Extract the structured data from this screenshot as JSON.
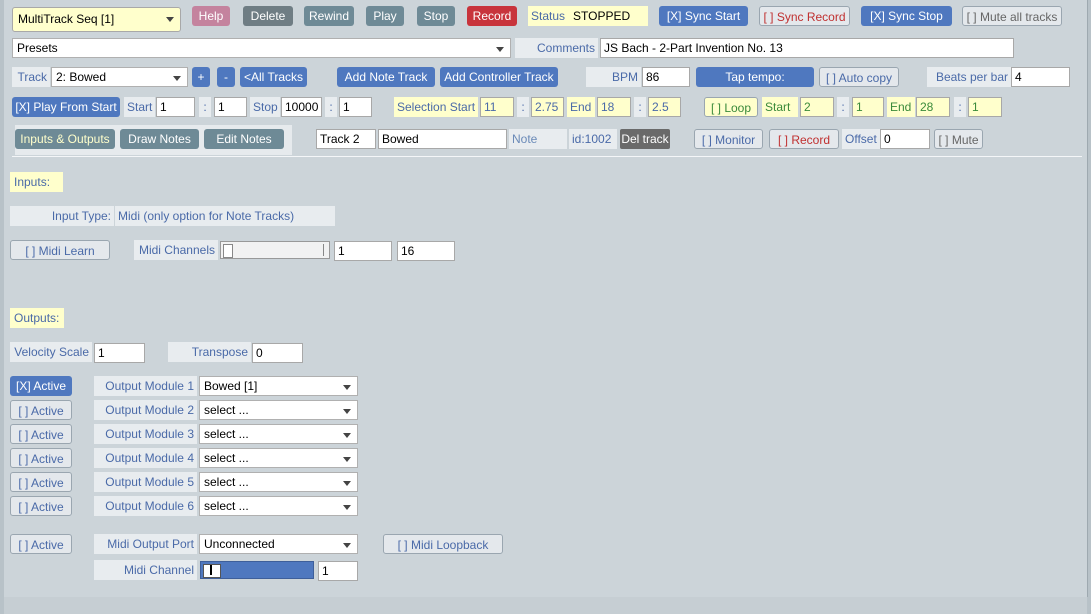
{
  "toolbar": {
    "app_title": "MultiTrack Seq [1]",
    "help": "Help",
    "delete": "Delete",
    "rewind": "Rewind",
    "play": "Play",
    "stop": "Stop",
    "record": "Record",
    "status_label": "Status",
    "status_value": "STOPPED",
    "sync_start": "[X] Sync Start",
    "sync_record": "[ ] Sync Record",
    "sync_stop": "[X] Sync Stop",
    "mute_all": "[ ] Mute all tracks"
  },
  "presets": {
    "value": "Presets",
    "comments_label": "Comments",
    "comments_value": "JS Bach - 2-Part Invention No. 13"
  },
  "track_row": {
    "track_label": "Track",
    "track_value": "2: Bowed",
    "plus": "+",
    "minus": "-",
    "all_tracks": "<All Tracks",
    "add_note_track": "Add Note Track",
    "add_controller_track": "Add Controller Track",
    "bpm_label": "BPM",
    "bpm_value": "86",
    "tap_tempo": "Tap tempo:",
    "auto_copy": "[ ] Auto copy",
    "beats_label": "Beats per bar",
    "beats_value": "4"
  },
  "transport": {
    "play_from_start": "[X] Play From Start",
    "start_label": "Start",
    "start_bar": "1",
    "colon": ":",
    "start_beat": "1",
    "stop_label": "Stop",
    "stop_bar": "10000",
    "stop_beat": "1",
    "selection_start_label": "Selection Start",
    "sel_start_bar": "11",
    "sel_start_beat": "2.75",
    "end_label": "End",
    "sel_end_bar": "18",
    "sel_end_beat": "2.5",
    "loop": "[ ] Loop",
    "loop_start_label": "Start",
    "loop_start_bar": "2",
    "loop_start_beat": "1",
    "loop_end_label": "End",
    "loop_end_bar": "28",
    "loop_end_beat": "1"
  },
  "tabs": {
    "inputs_outputs": "Inputs & Outputs",
    "draw_notes": "Draw Notes",
    "edit_notes": "Edit Notes"
  },
  "track_info": {
    "track_name": "Track 2",
    "instrument": "Bowed",
    "type": "Note",
    "id": "id:1002",
    "del_track": "Del track",
    "monitor": "[ ] Monitor",
    "record": "[ ] Record",
    "offset_label": "Offset",
    "offset_value": "0",
    "mute": "[ ] Mute"
  },
  "inputs": {
    "heading": "Inputs:",
    "input_type_label": "Input Type:",
    "input_type_value": "Midi (only option for Note Tracks)",
    "midi_learn": "[ ] Midi Learn",
    "midi_channels_label": "Midi Channels",
    "midi_channel_low": "1",
    "midi_channel_high": "16"
  },
  "outputs": {
    "heading": "Outputs:",
    "velocity_label": "Velocity Scale",
    "velocity_value": "1",
    "transpose_label": "Transpose",
    "transpose_value": "0",
    "modules": [
      {
        "active": "[X] Active",
        "label": "Output Module 1",
        "value": "Bowed [1]"
      },
      {
        "active": "[ ] Active",
        "label": "Output Module 2",
        "value": "select ..."
      },
      {
        "active": "[ ] Active",
        "label": "Output Module 3",
        "value": "select ..."
      },
      {
        "active": "[ ] Active",
        "label": "Output Module 4",
        "value": "select ..."
      },
      {
        "active": "[ ] Active",
        "label": "Output Module 5",
        "value": "select ..."
      },
      {
        "active": "[ ] Active",
        "label": "Output Module 6",
        "value": "select ..."
      }
    ],
    "midi_active": "[ ] Active",
    "midi_port_label": "Midi Output Port",
    "midi_port_value": "Unconnected",
    "midi_loopback": "[ ] Midi Loopback",
    "midi_channel_label": "Midi Channel",
    "midi_channel_value": "1"
  },
  "colors": {
    "panel_bg": "#ccd4d9",
    "accent_blue": "#4f78bf",
    "label_blue": "#4a6aa8",
    "highlight_yellow": "#ffffcc",
    "record_red": "#c8343c",
    "loop_green": "#3a8a3a"
  }
}
